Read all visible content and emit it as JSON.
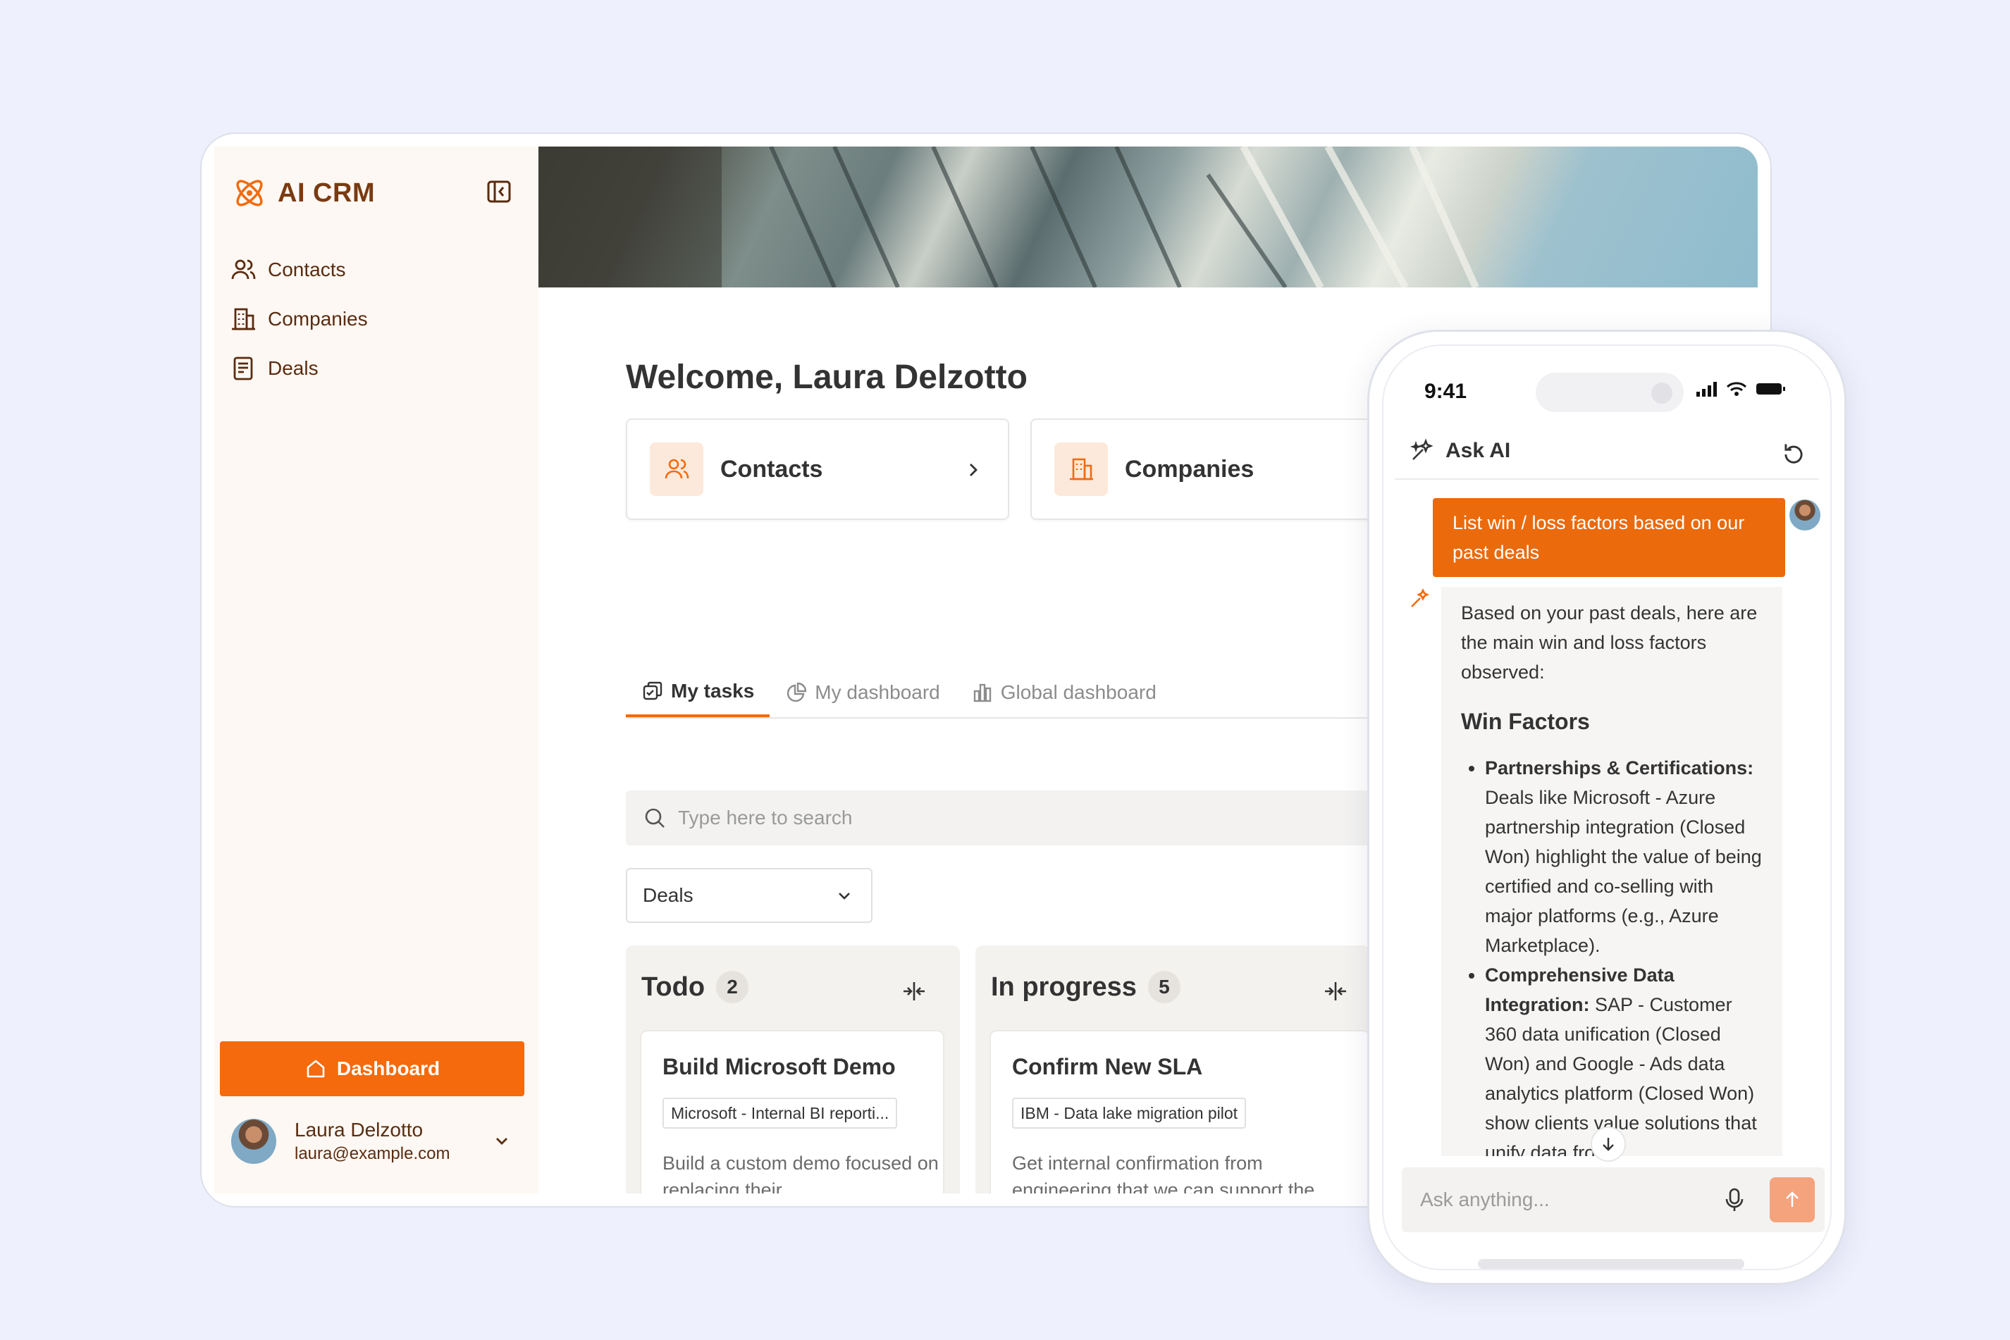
{
  "app": {
    "name": "AI CRM"
  },
  "sidebar": {
    "items": [
      {
        "label": "Contacts",
        "icon": "users-icon"
      },
      {
        "label": "Companies",
        "icon": "building-icon"
      },
      {
        "label": "Deals",
        "icon": "document-icon"
      }
    ],
    "dashboard_button": "Dashboard",
    "user": {
      "name": "Laura Delzotto",
      "email": "laura@example.com"
    }
  },
  "main": {
    "welcome": "Welcome, Laura Delzotto",
    "cards": [
      {
        "label": "Contacts",
        "icon": "users-icon"
      },
      {
        "label": "Companies",
        "icon": "building-icon"
      }
    ],
    "tabs": [
      {
        "label": "My tasks",
        "icon": "tasks-icon",
        "active": true
      },
      {
        "label": "My dashboard",
        "icon": "pie-chart-icon",
        "active": false
      },
      {
        "label": "Global dashboard",
        "icon": "bar-chart-icon",
        "active": false
      }
    ],
    "search_placeholder": "Type here to search",
    "filter_selected": "Deals",
    "columns": [
      {
        "title": "Todo",
        "count": "2",
        "task": {
          "title": "Build Microsoft Demo",
          "tag": "Microsoft - Internal BI reporti...",
          "desc": "Build a custom demo focused on replacing their"
        }
      },
      {
        "title": "In progress",
        "count": "5",
        "task": {
          "title": "Confirm New SLA",
          "tag": "IBM - Data lake migration pilot",
          "desc": "Get internal confirmation from engineering that we can support the"
        }
      }
    ]
  },
  "phone": {
    "time": "9:41",
    "chat_title": "Ask AI",
    "user_message": "List win / loss factors based on our past deals",
    "ai_intro": "Based on your past deals, here are the main win and loss factors observed:",
    "ai_heading": "Win Factors",
    "ai_points": [
      {
        "bold": "Partnerships & Certifications:",
        "text": " Deals like Microsoft - Azure partnership integration (Closed Won) highlight the value of being certified and co-selling with major platforms (e.g., Azure Marketplace)."
      },
      {
        "bold": "Comprehensive Data Integration:",
        "text": " SAP - Customer 360 data unification (Closed Won) and Google - Ads data analytics platform (Closed Won) show clients value solutions that unify data from"
      }
    ],
    "input_placeholder": "Ask anything..."
  },
  "colors": {
    "accent": "#f46a0c",
    "sidebar_bg": "#fdf8f3",
    "brand_text": "#7a3a12"
  }
}
